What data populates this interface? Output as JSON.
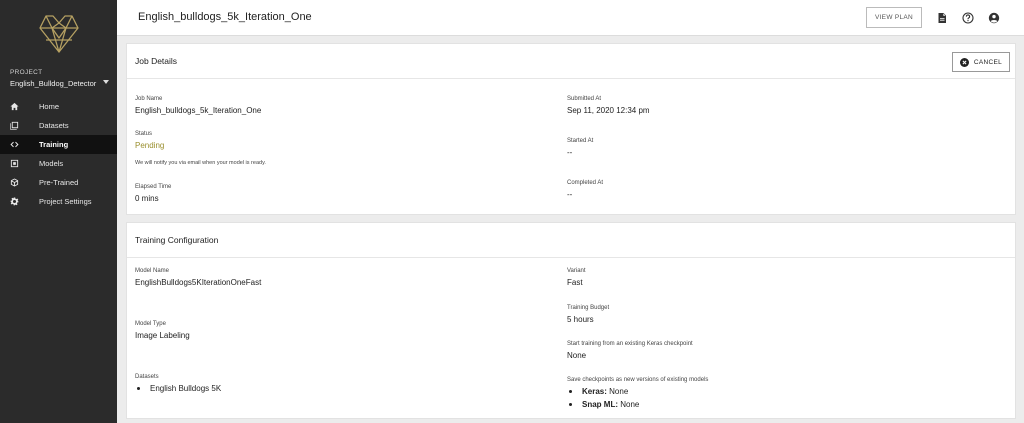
{
  "sidebar": {
    "project_label": "PROJECT",
    "project_name": "English_Bulldog_Detector",
    "items": [
      {
        "label": "Home",
        "icon": "home-icon"
      },
      {
        "label": "Datasets",
        "icon": "datasets-icon"
      },
      {
        "label": "Training",
        "icon": "code-icon",
        "active": true
      },
      {
        "label": "Models",
        "icon": "models-icon"
      },
      {
        "label": "Pre-Trained",
        "icon": "cube-icon"
      },
      {
        "label": "Project Settings",
        "icon": "gear-icon"
      }
    ]
  },
  "header": {
    "title": "English_bulldogs_5k_Iteration_One",
    "view_plan_label": "VIEW PLAN",
    "icons": [
      "document-icon",
      "help-icon",
      "account-icon"
    ]
  },
  "job_details": {
    "title": "Job Details",
    "cancel_label": "CANCEL",
    "job_name_label": "Job Name",
    "job_name": "English_bulldogs_5k_Iteration_One",
    "status_label": "Status",
    "status": "Pending",
    "status_note": "We will notify you via email when your model is ready.",
    "elapsed_label": "Elapsed Time",
    "elapsed": "0 mins",
    "submitted_label": "Submitted At",
    "submitted": "Sep 11, 2020 12:34 pm",
    "started_label": "Started At",
    "started": "--",
    "completed_label": "Completed At",
    "completed": "--"
  },
  "training_config": {
    "title": "Training Configuration",
    "model_name_label": "Model Name",
    "model_name": "EnglishBulldogs5KIterationOneFast",
    "model_type_label": "Model Type",
    "model_type": "Image Labeling",
    "datasets_label": "Datasets",
    "datasets": [
      "English Bulldogs 5K"
    ],
    "variant_label": "Variant",
    "variant": "Fast",
    "budget_label": "Training Budget",
    "budget": "5 hours",
    "checkpoint_label": "Start training from an existing Keras checkpoint",
    "checkpoint": "None",
    "save_label": "Save checkpoints as new versions of existing models",
    "save_items": [
      {
        "name": "Keras:",
        "value": "None"
      },
      {
        "name": "Snap ML:",
        "value": "None"
      }
    ]
  },
  "colors": {
    "sidebar_bg": "#2b2b2b",
    "active_bg": "#111111",
    "logo_gold": "#b5a062",
    "pending": "#9a8f2e"
  }
}
